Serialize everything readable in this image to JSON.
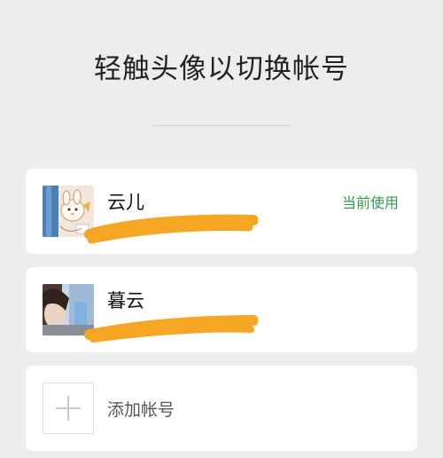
{
  "header": {
    "title": "轻触头像以切换帐号"
  },
  "accounts": [
    {
      "name": "云儿",
      "status": "当前使用"
    },
    {
      "name": "暮云",
      "status": ""
    }
  ],
  "add_account": {
    "label": "添加帐号"
  },
  "colors": {
    "background": "#ededed",
    "card": "#ffffff",
    "accent_green": "#2e9c4e",
    "redaction_orange": "#f5a623"
  }
}
